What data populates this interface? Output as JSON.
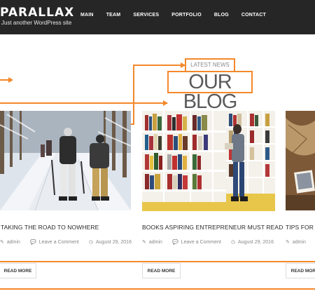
{
  "header": {
    "logo": "PARALLAX",
    "tagline": "Just another WordPress site",
    "nav": [
      "MAIN",
      "TEAM",
      "SERVICES",
      "PORTFOLIO",
      "BLOG",
      "CONTACT"
    ]
  },
  "section": {
    "eyebrow": "LATEST NEWS",
    "title": "OUR BLOG"
  },
  "posts": [
    {
      "title": "TAKING THE ROAD TO NOWHERE",
      "author": "admin",
      "comments": "Leave a Comment",
      "date": "August 29, 2016",
      "read_more": "READ MORE"
    },
    {
      "title": "BOOKS ASPIRING ENTREPRENEUR MUST READ",
      "author": "admin",
      "comments": "Leave a Comment",
      "date": "August 29, 2016",
      "read_more": "READ MORE"
    },
    {
      "title": "TIPS FOR S",
      "author": "admin",
      "comments": "",
      "date": "",
      "read_more": "READ MORE"
    }
  ],
  "colors": {
    "header_bg": "#262626",
    "accent": "#f5882a"
  }
}
